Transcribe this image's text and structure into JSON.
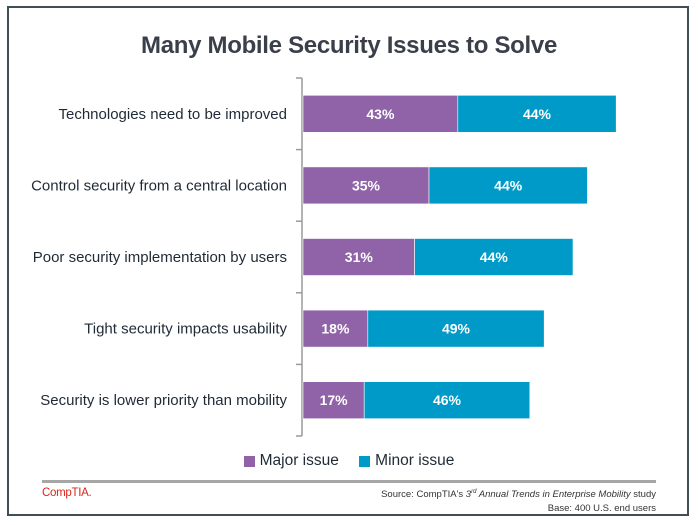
{
  "colors": {
    "major": "#9063a8",
    "minor": "#009ac8",
    "axis": "#9a9a9a",
    "frame": "#3f4f55",
    "logo": "#d9261c"
  },
  "footer": {
    "logo_text": "CompTIA.",
    "source_prefix": "Source: CompTIA's ",
    "source_ordinal_num": "3",
    "source_ordinal_sup": "rd",
    "source_title": "Annual Trends in Enterprise Mobility",
    "source_suffix": " study",
    "base": "Base: 400 U.S. end users"
  },
  "chart_data": {
    "type": "bar",
    "orientation": "horizontal",
    "stacked": true,
    "title": "Many Mobile Security Issues to Solve",
    "xlabel": "",
    "ylabel": "",
    "xlim": [
      0,
      100
    ],
    "grid": false,
    "legend_position": "bottom",
    "categories": [
      "Technologies need to be improved",
      "Control security from a central location",
      "Poor security implementation by users",
      "Tight security impacts usability",
      "Security is lower priority than mobility"
    ],
    "series": [
      {
        "name": "Major issue",
        "color": "#9063a8",
        "values": [
          43,
          35,
          31,
          18,
          17
        ]
      },
      {
        "name": "Minor issue",
        "color": "#009ac8",
        "values": [
          44,
          44,
          44,
          49,
          46
        ]
      }
    ],
    "value_suffix": "%"
  }
}
